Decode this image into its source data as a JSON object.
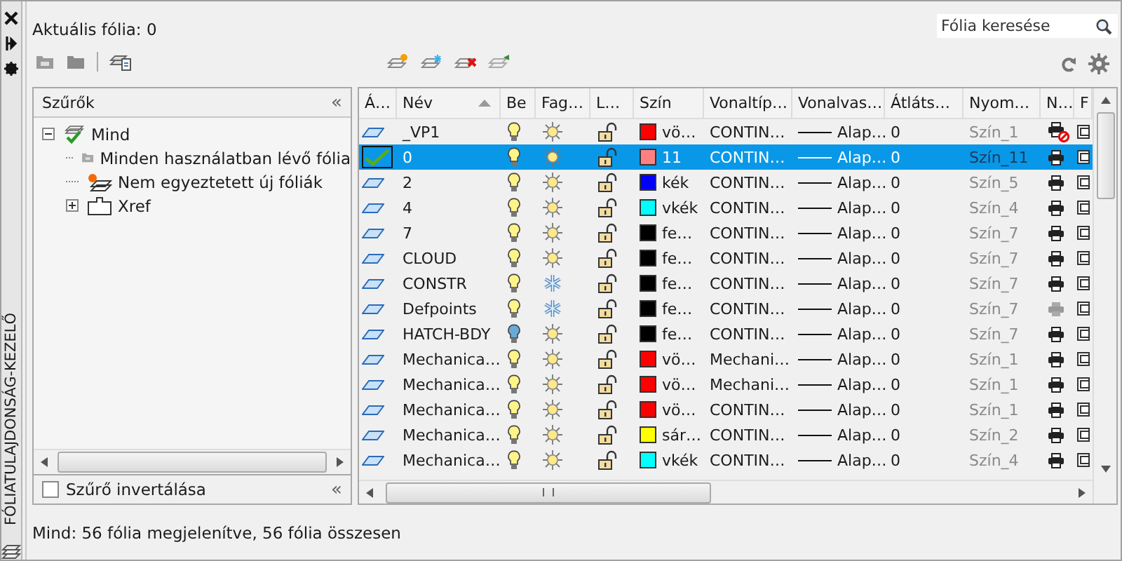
{
  "side_title": "FÓLIATULAJDONSÁG-KEZELŐ",
  "current_layer": "Aktuális fólia: 0",
  "search": {
    "placeholder": "Fólia keresése"
  },
  "filters": {
    "title": "Szűrők",
    "collapse": "«",
    "tree": [
      {
        "label": "Mind",
        "expanded": true,
        "children": [
          {
            "label": "Minden használatban lévő fólia",
            "kind": "used"
          },
          {
            "label": "Nem egyeztetett új fóliák",
            "kind": "new"
          },
          {
            "label": "Xref",
            "kind": "xref",
            "expanded": false
          }
        ]
      }
    ],
    "invert": {
      "label": "Szűrő invertálása",
      "checked": false
    },
    "collapse_bottom": "«"
  },
  "table": {
    "columns": [
      {
        "label": "Á…",
        "sorted": false
      },
      {
        "label": "Név",
        "sorted": true
      },
      {
        "label": "Be",
        "sorted": false
      },
      {
        "label": "Fag…",
        "sorted": false
      },
      {
        "label": "L…",
        "sorted": false
      },
      {
        "label": "Szín",
        "sorted": false
      },
      {
        "label": "Vonaltíp…",
        "sorted": false
      },
      {
        "label": "Vonalvas…",
        "sorted": false
      },
      {
        "label": "Átláts…",
        "sorted": false
      },
      {
        "label": "Nyom…",
        "sorted": false
      },
      {
        "label": "N…",
        "sorted": false
      },
      {
        "label": "F",
        "sorted": false
      }
    ],
    "rows": [
      {
        "name": "_VP1",
        "current": false,
        "selected": false,
        "on": true,
        "frozen": false,
        "locked": false,
        "color": "#ff0000",
        "color_name": "vö…",
        "linetype": "CONTIN…",
        "lineweight": "Alap…",
        "transparency": "0",
        "plot_style": "Szín_1",
        "plot": false,
        "plot_greyed": false
      },
      {
        "name": "0",
        "current": true,
        "selected": true,
        "on": true,
        "frozen": false,
        "locked": false,
        "color": "#ff8080",
        "color_name": "11",
        "linetype": "CONTIN…",
        "lineweight": "Alap…",
        "transparency": "0",
        "plot_style": "Szín_11",
        "plot": true,
        "plot_greyed": false
      },
      {
        "name": "2",
        "current": false,
        "selected": false,
        "on": true,
        "frozen": false,
        "locked": false,
        "color": "#0000ff",
        "color_name": "kék",
        "linetype": "CONTIN…",
        "lineweight": "Alap…",
        "transparency": "0",
        "plot_style": "Szín_5",
        "plot": true,
        "plot_greyed": false
      },
      {
        "name": "4",
        "current": false,
        "selected": false,
        "on": true,
        "frozen": false,
        "locked": false,
        "color": "#00ffff",
        "color_name": "vkék",
        "linetype": "CONTIN…",
        "lineweight": "Alap…",
        "transparency": "0",
        "plot_style": "Szín_4",
        "plot": true,
        "plot_greyed": false
      },
      {
        "name": "7",
        "current": false,
        "selected": false,
        "on": true,
        "frozen": false,
        "locked": false,
        "color": "#000000",
        "color_name": "fe…",
        "linetype": "CONTIN…",
        "lineweight": "Alap…",
        "transparency": "0",
        "plot_style": "Szín_7",
        "plot": true,
        "plot_greyed": false
      },
      {
        "name": "CLOUD",
        "current": false,
        "selected": false,
        "on": true,
        "frozen": false,
        "locked": false,
        "color": "#000000",
        "color_name": "fe…",
        "linetype": "CONTIN…",
        "lineweight": "Alap…",
        "transparency": "0",
        "plot_style": "Szín_7",
        "plot": true,
        "plot_greyed": false
      },
      {
        "name": "CONSTR",
        "current": false,
        "selected": false,
        "on": true,
        "frozen": true,
        "locked": false,
        "color": "#000000",
        "color_name": "fe…",
        "linetype": "CONTIN…",
        "lineweight": "Alap…",
        "transparency": "0",
        "plot_style": "Szín_7",
        "plot": true,
        "plot_greyed": false
      },
      {
        "name": "Defpoints",
        "current": false,
        "selected": false,
        "on": true,
        "frozen": true,
        "locked": false,
        "color": "#000000",
        "color_name": "fe…",
        "linetype": "CONTIN…",
        "lineweight": "Alap…",
        "transparency": "0",
        "plot_style": "Szín_7",
        "plot": true,
        "plot_greyed": true
      },
      {
        "name": "HATCH-BDY",
        "current": false,
        "selected": false,
        "on": false,
        "frozen": false,
        "locked": false,
        "color": "#000000",
        "color_name": "fe…",
        "linetype": "CONTIN…",
        "lineweight": "Alap…",
        "transparency": "0",
        "plot_style": "Szín_7",
        "plot": true,
        "plot_greyed": false
      },
      {
        "name": "Mechanica…",
        "current": false,
        "selected": false,
        "on": true,
        "frozen": false,
        "locked": false,
        "color": "#ff0000",
        "color_name": "vö…",
        "linetype": "Mechani…",
        "lineweight": "Alap…",
        "transparency": "0",
        "plot_style": "Szín_1",
        "plot": true,
        "plot_greyed": false
      },
      {
        "name": "Mechanica…",
        "current": false,
        "selected": false,
        "on": true,
        "frozen": false,
        "locked": false,
        "color": "#ff0000",
        "color_name": "vö…",
        "linetype": "Mechani…",
        "lineweight": "Alap…",
        "transparency": "0",
        "plot_style": "Szín_1",
        "plot": true,
        "plot_greyed": false
      },
      {
        "name": "Mechanica…",
        "current": false,
        "selected": false,
        "on": true,
        "frozen": false,
        "locked": false,
        "color": "#ff0000",
        "color_name": "vö…",
        "linetype": "CONTIN…",
        "lineweight": "Alap…",
        "transparency": "0",
        "plot_style": "Szín_1",
        "plot": true,
        "plot_greyed": false
      },
      {
        "name": "Mechanica…",
        "current": false,
        "selected": false,
        "on": true,
        "frozen": false,
        "locked": false,
        "color": "#ffff00",
        "color_name": "sár…",
        "linetype": "CONTIN…",
        "lineweight": "Alap…",
        "transparency": "0",
        "plot_style": "Szín_2",
        "plot": true,
        "plot_greyed": false
      },
      {
        "name": "Mechanica…",
        "current": false,
        "selected": false,
        "on": true,
        "frozen": false,
        "locked": false,
        "color": "#00ffff",
        "color_name": "vkék",
        "linetype": "CONTIN…",
        "lineweight": "Alap…",
        "transparency": "0",
        "plot_style": "Szín_4",
        "plot": true,
        "plot_greyed": false
      }
    ]
  },
  "status_bar": "Mind: 56 fólia megjelenítve, 56 fólia összesen"
}
